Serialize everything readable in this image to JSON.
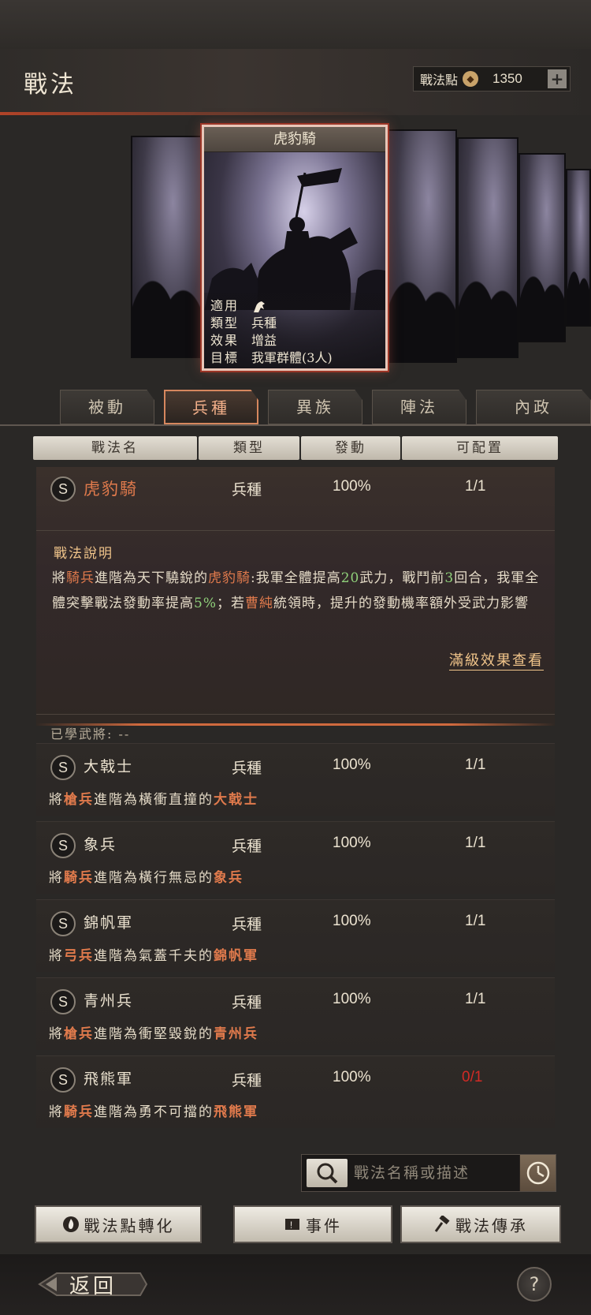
{
  "header": {
    "title": "戰法",
    "points_label": "戰法點",
    "points_value": "1350",
    "plus_label": "+"
  },
  "card": {
    "name": "虎豹騎",
    "info": [
      {
        "key": "適用",
        "value": ""
      },
      {
        "key": "類型",
        "value": "兵種"
      },
      {
        "key": "效果",
        "value": "增益"
      },
      {
        "key": "目標",
        "value": "我軍群體(3人)"
      }
    ]
  },
  "tabs": [
    "被動",
    "兵種",
    "異族",
    "陣法",
    "內政"
  ],
  "active_tab": "兵種",
  "columns": [
    "戰法名",
    "類型",
    "發動",
    "可配置"
  ],
  "selected": {
    "badge": "S",
    "name": "虎豹騎",
    "type": "兵種",
    "rate": "100%",
    "slots": "1/1",
    "desc_title": "戰法說明",
    "desc": {
      "p1": "將",
      "h1": "騎兵",
      "p2": "進階為天下驍銳的",
      "h2": "虎豹騎",
      "p3": ":我軍全體提高",
      "n1": "20",
      "p4": "武力，戰鬥前",
      "n2": "3",
      "p5": "回合，我軍全體突擊戰法發動率提高",
      "n3": "5%",
      "p6": "；若",
      "h3": "曹純",
      "p7": "統領時，提升的發動機率額外受武力影響"
    },
    "full_effect_link": "滿級效果查看",
    "learned": "已學武將: --"
  },
  "items": [
    {
      "badge": "S",
      "name": "大戟士",
      "type": "兵種",
      "rate": "100%",
      "slots": "1/1",
      "slots_red": false,
      "sub": {
        "a": "將",
        "b": "槍兵",
        "c": "進階為橫衝直撞的",
        "d": "大戟士"
      }
    },
    {
      "badge": "S",
      "name": "象兵",
      "type": "兵種",
      "rate": "100%",
      "slots": "1/1",
      "slots_red": false,
      "sub": {
        "a": "將",
        "b": "騎兵",
        "c": "進階為橫行無忌的",
        "d": "象兵"
      }
    },
    {
      "badge": "S",
      "name": "錦帆軍",
      "type": "兵種",
      "rate": "100%",
      "slots": "1/1",
      "slots_red": false,
      "sub": {
        "a": "將",
        "b": "弓兵",
        "c": "進階為氣蓋千夫的",
        "d": "錦帆軍"
      }
    },
    {
      "badge": "S",
      "name": "青州兵",
      "type": "兵種",
      "rate": "100%",
      "slots": "1/1",
      "slots_red": false,
      "sub": {
        "a": "將",
        "b": "槍兵",
        "c": "進階為衝堅毀銳的",
        "d": "青州兵"
      }
    },
    {
      "badge": "S",
      "name": "飛熊軍",
      "type": "兵種",
      "rate": "100%",
      "slots": "0/1",
      "slots_red": true,
      "sub": {
        "a": "將",
        "b": "騎兵",
        "c": "進階為勇不可擋的",
        "d": "飛熊軍"
      }
    }
  ],
  "search": {
    "placeholder": "戰法名稱或描述"
  },
  "buttons": {
    "convert": "戰法點轉化",
    "event": "事件",
    "inherit": "戰法傳承"
  },
  "footer": {
    "back": "返回",
    "help": "?"
  },
  "colors": {
    "accent": "#e07a4c",
    "highlight_green": "#8fd07a",
    "warning_red": "#d22a25"
  }
}
